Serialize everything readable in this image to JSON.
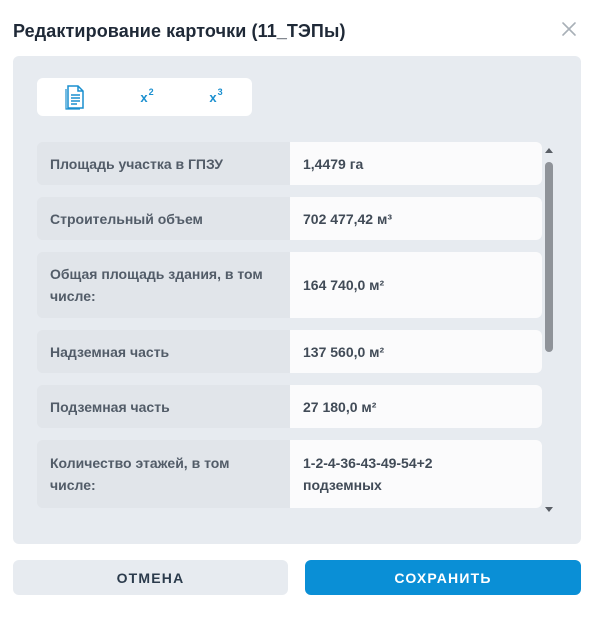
{
  "dialog": {
    "title": "Редактирование карточки (11_ТЭПы)"
  },
  "tabs": [
    {
      "icon": "document-icon"
    },
    {
      "base": "x",
      "sup": "2"
    },
    {
      "base": "x",
      "sup": "3"
    }
  ],
  "rows": [
    {
      "label": [
        "Площадь участка в ГПЗУ"
      ],
      "value": [
        "1,4479 га"
      ]
    },
    {
      "label": [
        "Строительный объем"
      ],
      "value": [
        "702 477,42 м³"
      ]
    },
    {
      "label": [
        "Общая площадь здания, в том",
        "числе:"
      ],
      "value": [
        "164 740,0 м²"
      ]
    },
    {
      "label": [
        "Надземная часть"
      ],
      "value": [
        "137 560,0 м²"
      ]
    },
    {
      "label": [
        "Подземная часть"
      ],
      "value": [
        "27 180,0 м²"
      ]
    },
    {
      "label": [
        "Количество этажей, в том",
        "числе:"
      ],
      "value": [
        "1-2-4-36-43-49-54+2",
        "подземных"
      ]
    }
  ],
  "buttons": {
    "cancel": "ОТМЕНА",
    "save": "СОХРАНИТЬ"
  },
  "colors": {
    "accent": "#0a8fd6",
    "panel": "#e7ebf0"
  }
}
